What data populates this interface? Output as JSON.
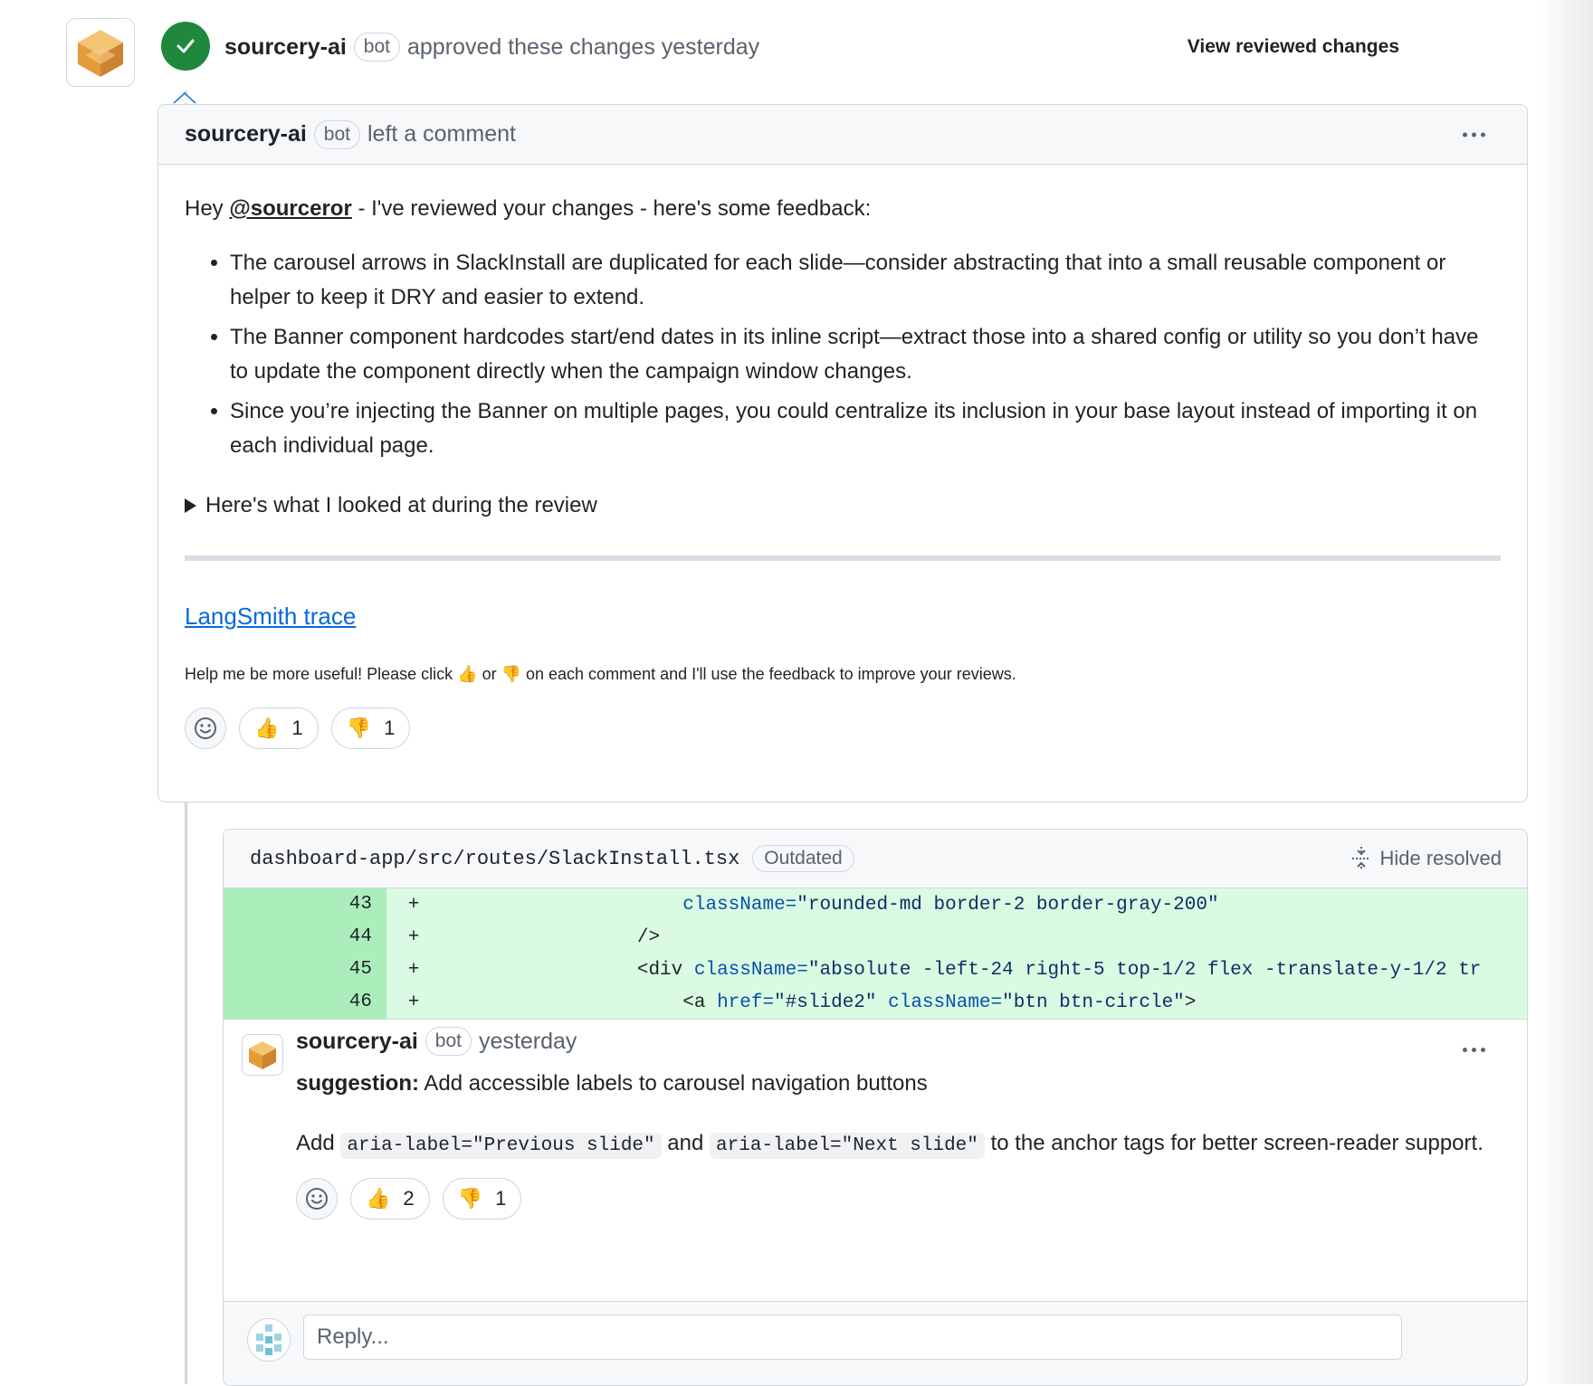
{
  "review": {
    "author": "sourcery-ai",
    "badge": "bot",
    "action": "approved these changes yesterday",
    "view_changes": "View reviewed changes"
  },
  "comment": {
    "author": "sourcery-ai",
    "badge": "bot",
    "action": "left a comment",
    "greeting_prefix": "Hey ",
    "mention": "@sourceror",
    "greeting_suffix": " - I've reviewed your changes - here's some feedback:",
    "points": [
      "The carousel arrows in SlackInstall are duplicated for each slide—consider abstracting that into a small reusable component or helper to keep it DRY and easier to extend.",
      "The Banner component hardcodes start/end dates in its inline script—extract those into a shared config or utility so you don’t have to update the component directly when the campaign window changes.",
      "Since you’re injecting the Banner on multiple pages, you could centralize its inclusion in your base layout instead of importing it on each individual page."
    ],
    "details_summary": "Here's what I looked at during the review",
    "link": "LangSmith trace",
    "note_before": "Help me be more useful! Please click ",
    "note_middle": " or ",
    "note_after": " on each comment and I'll use the feedback to improve your reviews.",
    "reactions": {
      "thumbs_up": "1",
      "thumbs_down": "1"
    }
  },
  "thread": {
    "file_path": "dashboard-app/src/routes/SlackInstall.tsx",
    "status": "Outdated",
    "hide_resolved": "Hide resolved",
    "diff": [
      {
        "line": "43",
        "sign": "+",
        "indent": "                      ",
        "tokens": [
          {
            "t": "attr",
            "v": "className="
          },
          {
            "t": "str",
            "v": "\"rounded-md border-2 border-gray-200\""
          }
        ]
      },
      {
        "line": "44",
        "sign": "+",
        "indent": "                  ",
        "tokens": [
          {
            "t": "plain",
            "v": "/>"
          }
        ]
      },
      {
        "line": "45",
        "sign": "+",
        "indent": "                  ",
        "tokens": [
          {
            "t": "plain",
            "v": "<div "
          },
          {
            "t": "attr",
            "v": "className="
          },
          {
            "t": "str",
            "v": "\"absolute -left-24 right-5 top-1/2 flex -translate-y-1/2 tr"
          }
        ]
      },
      {
        "line": "46",
        "sign": "+",
        "indent": "                      ",
        "tokens": [
          {
            "t": "plain",
            "v": "<a "
          },
          {
            "t": "attr",
            "v": "href="
          },
          {
            "t": "str",
            "v": "\"#slide2\" "
          },
          {
            "t": "attr",
            "v": "className="
          },
          {
            "t": "str",
            "v": "\"btn btn-circle\""
          },
          {
            "t": "plain",
            "v": ">"
          }
        ]
      }
    ],
    "reply": {
      "author": "sourcery-ai",
      "badge": "bot",
      "time": "yesterday",
      "label": "suggestion:",
      "title": " Add accessible labels to carousel navigation buttons",
      "body_prefix": "Add ",
      "code1": "aria-label=\"Previous slide\"",
      "body_mid": " and ",
      "code2": "aria-label=\"Next slide\"",
      "body_suffix": " to the anchor tags for better screen-reader support.",
      "reactions": {
        "thumbs_up": "2",
        "thumbs_down": "1"
      }
    },
    "reply_placeholder": "Reply..."
  },
  "colors": {
    "approved": "#1f883d",
    "link": "#0969da",
    "diff_added": "#dafbe1",
    "diff_gutter": "#aceebb"
  },
  "icons": [
    "sourcery-avatar",
    "check-icon",
    "kebab-icon",
    "triangle-icon",
    "smiley-icon",
    "thumbs-up-icon",
    "thumbs-down-icon",
    "unfold-icon",
    "user-identicon"
  ]
}
